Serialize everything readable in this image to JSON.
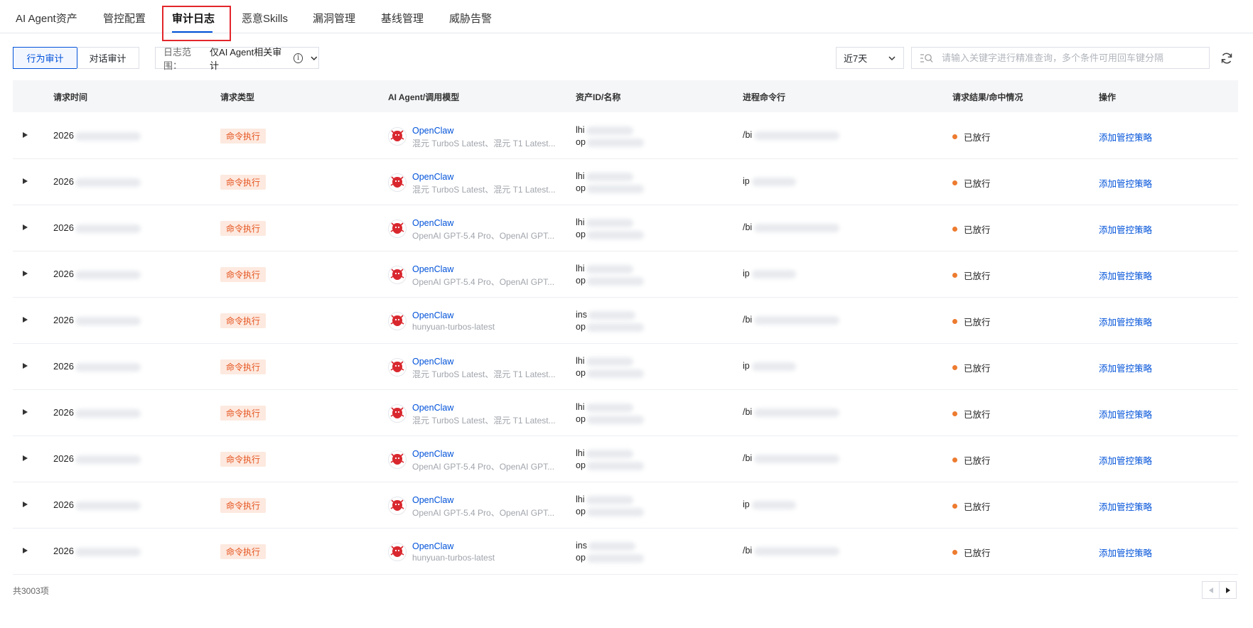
{
  "tabs": [
    "AI Agent资产",
    "管控配置",
    "审计日志",
    "恶意Skills",
    "漏洞管理",
    "基线管理",
    "威胁告警"
  ],
  "active_tab": "审计日志",
  "toolbar": {
    "segments": [
      "行为审计",
      "对话审计"
    ],
    "scope_label": "日志范围：",
    "scope_value": "仅AI Agent相关审计",
    "period": "近7天",
    "search_placeholder": "请输入关键字进行精准查询，多个条件可用回车键分隔"
  },
  "columns": [
    "请求时间",
    "请求类型",
    "AI Agent/调用模型",
    "资产ID/名称",
    "进程命令行",
    "请求结果/命中情况",
    "操作"
  ],
  "rows": [
    {
      "time": "2026",
      "type": "命令执行",
      "agent": "OpenClaw",
      "model": "混元 TurboS Latest、混元 T1 Latest...",
      "asset1": "lhi",
      "asset2": "op",
      "cmd": "/bi",
      "result": "已放行",
      "action": "添加管控策略"
    },
    {
      "time": "2026",
      "type": "命令执行",
      "agent": "OpenClaw",
      "model": "混元 TurboS Latest、混元 T1 Latest...",
      "asset1": "lhi",
      "asset2": "op",
      "cmd": "ip",
      "result": "已放行",
      "action": "添加管控策略"
    },
    {
      "time": "2026",
      "type": "命令执行",
      "agent": "OpenClaw",
      "model": "OpenAI GPT-5.4 Pro、OpenAI GPT...",
      "asset1": "lhi",
      "asset2": "op",
      "cmd": "/bi",
      "result": "已放行",
      "action": "添加管控策略"
    },
    {
      "time": "2026",
      "type": "命令执行",
      "agent": "OpenClaw",
      "model": "OpenAI GPT-5.4 Pro、OpenAI GPT...",
      "asset1": "lhi",
      "asset2": "op",
      "cmd": "ip",
      "result": "已放行",
      "action": "添加管控策略"
    },
    {
      "time": "2026",
      "type": "命令执行",
      "agent": "OpenClaw",
      "model": "hunyuan-turbos-latest",
      "asset1": "ins",
      "asset2": "op",
      "cmd": "/bi",
      "result": "已放行",
      "action": "添加管控策略"
    },
    {
      "time": "2026",
      "type": "命令执行",
      "agent": "OpenClaw",
      "model": "混元 TurboS Latest、混元 T1 Latest...",
      "asset1": "lhi",
      "asset2": "op",
      "cmd": "ip",
      "result": "已放行",
      "action": "添加管控策略"
    },
    {
      "time": "2026",
      "type": "命令执行",
      "agent": "OpenClaw",
      "model": "混元 TurboS Latest、混元 T1 Latest...",
      "asset1": "lhi",
      "asset2": "op",
      "cmd": "/bi",
      "result": "已放行",
      "action": "添加管控策略"
    },
    {
      "time": "2026",
      "type": "命令执行",
      "agent": "OpenClaw",
      "model": "OpenAI GPT-5.4 Pro、OpenAI GPT...",
      "asset1": "lhi",
      "asset2": "op",
      "cmd": "/bi",
      "result": "已放行",
      "action": "添加管控策略"
    },
    {
      "time": "2026",
      "type": "命令执行",
      "agent": "OpenClaw",
      "model": "OpenAI GPT-5.4 Pro、OpenAI GPT...",
      "asset1": "lhi",
      "asset2": "op",
      "cmd": "ip",
      "result": "已放行",
      "action": "添加管控策略"
    },
    {
      "time": "2026",
      "type": "命令执行",
      "agent": "OpenClaw",
      "model": "hunyuan-turbos-latest",
      "asset1": "ins",
      "asset2": "op",
      "cmd": "/bi",
      "result": "已放行",
      "action": "添加管控策略"
    }
  ],
  "footer": {
    "total": "共3003项"
  },
  "colors": {
    "accent": "#0052d9",
    "badge_bg": "#fde9df",
    "badge_text": "#e5531e",
    "status_dot": "#ed7b2f",
    "highlight": "#e3262b"
  },
  "icons": [
    "info-icon",
    "chevron-down-icon",
    "search-icon",
    "refresh-icon",
    "expand-icon",
    "openclaw-logo-icon",
    "prev-page-icon",
    "next-page-icon"
  ]
}
